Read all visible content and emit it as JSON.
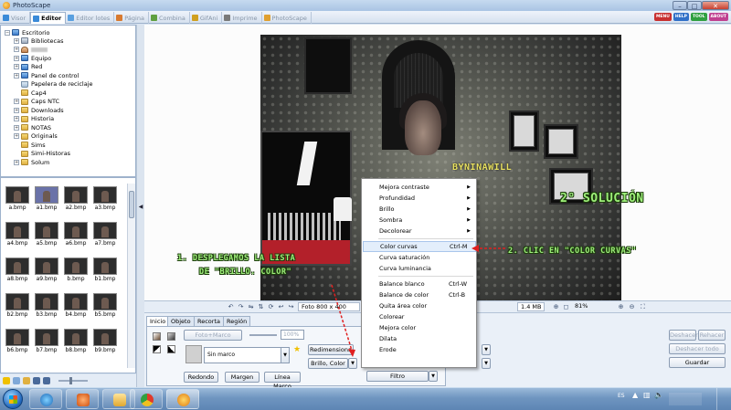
{
  "window": {
    "title": "PhotoScape",
    "min": "–",
    "max": "□",
    "close": "✕"
  },
  "tabs": [
    {
      "label": "Visor",
      "color": "#3a8ad8",
      "active": false
    },
    {
      "label": "Editor",
      "color": "#3a8ad8",
      "active": true
    },
    {
      "label": "Editor lotes",
      "color": "#5aa0e0",
      "active": false
    },
    {
      "label": "Página",
      "color": "#d87a30",
      "active": false
    },
    {
      "label": "Combina",
      "color": "#60a040",
      "active": false
    },
    {
      "label": "GifAni",
      "color": "#d0a020",
      "active": false
    },
    {
      "label": "Imprime",
      "color": "#7a7a7a",
      "active": false
    },
    {
      "label": "PhotoScape",
      "color": "#e0a030",
      "active": false
    }
  ],
  "header_buttons": [
    {
      "label": "MENU",
      "color": "#c83030"
    },
    {
      "label": "HELP",
      "color": "#3070c8"
    },
    {
      "label": "TOOL",
      "color": "#30a040"
    },
    {
      "label": "ABOUT",
      "color": "#c04090"
    }
  ],
  "tree": {
    "root": "Escritorio",
    "items": [
      {
        "label": "Bibliotecas",
        "icon": "library",
        "expander": "+"
      },
      {
        "label": "",
        "icon": "user",
        "expander": "+"
      },
      {
        "label": "Equipo",
        "icon": "computer",
        "expander": "+"
      },
      {
        "label": "Red",
        "icon": "network",
        "expander": "+"
      },
      {
        "label": "Panel de control",
        "icon": "control",
        "expander": "+"
      },
      {
        "label": "Papelera de reciclaje",
        "icon": "bin",
        "expander": ""
      },
      {
        "label": "Cap4",
        "icon": "folder",
        "expander": ""
      },
      {
        "label": "Caps NTC",
        "icon": "folder",
        "expander": "+"
      },
      {
        "label": "Downloads",
        "icon": "folder",
        "expander": "+"
      },
      {
        "label": "Historia",
        "icon": "folder",
        "expander": "+"
      },
      {
        "label": "NOTAS",
        "icon": "folder",
        "expander": "+"
      },
      {
        "label": "Originals",
        "icon": "folder",
        "expander": "+"
      },
      {
        "label": "Sims",
        "icon": "folder",
        "expander": ""
      },
      {
        "label": "Simi-Historas",
        "icon": "folder",
        "expander": ""
      },
      {
        "label": "Solum",
        "icon": "folder",
        "expander": "+"
      }
    ]
  },
  "thumbnails": [
    "a.bmp",
    "a1.bmp",
    "a2.bmp",
    "a3.bmp",
    "a4.bmp",
    "a5.bmp",
    "a6.bmp",
    "a7.bmp",
    "a8.bmp",
    "a9.bmp",
    "b.bmp",
    "b1.bmp",
    "b2.bmp",
    "b3.bmp",
    "b4.bmp",
    "b5.bmp",
    "b6.bmp",
    "b7.bmp",
    "b8.bmp",
    "b9.bmp"
  ],
  "canvas": {
    "watermark": "BYNINAWILL",
    "annotation_solution": "2° SOLUCIÓN",
    "annotation_step1_line1": "1. DESPLEGAMOS LA LISTA",
    "annotation_step1_line2": "DE \"BRILLO. COLOR\"",
    "annotation_step2": "2. CLIC EN \"COLOR CURVAS\""
  },
  "context_menu": {
    "items": [
      {
        "label": "Mejora contraste",
        "shortcut": "",
        "submenu": true
      },
      {
        "label": "Profundidad",
        "shortcut": "",
        "submenu": true
      },
      {
        "label": "Brillo",
        "shortcut": "",
        "submenu": true
      },
      {
        "label": "Sombra",
        "shortcut": "",
        "submenu": true
      },
      {
        "label": "Decolorear",
        "shortcut": "",
        "submenu": true
      },
      {
        "sep": true
      },
      {
        "label": "Color curvas",
        "shortcut": "Ctrl-M",
        "submenu": false,
        "highlight": true
      },
      {
        "label": "Curva saturación",
        "shortcut": "",
        "submenu": false
      },
      {
        "label": "Curva luminancia",
        "shortcut": "",
        "submenu": false
      },
      {
        "sep": true
      },
      {
        "label": "Balance blanco",
        "shortcut": "Ctrl-W",
        "submenu": false
      },
      {
        "label": "Balance de color",
        "shortcut": "Ctrl-B",
        "submenu": false
      },
      {
        "label": "Quita área color",
        "shortcut": "",
        "submenu": false
      },
      {
        "label": "Colorear",
        "shortcut": "",
        "submenu": false
      },
      {
        "label": "Mejora color",
        "shortcut": "",
        "submenu": false
      },
      {
        "label": "Dilata",
        "shortcut": "",
        "submenu": false
      },
      {
        "label": "Erode",
        "shortcut": "",
        "submenu": false
      }
    ]
  },
  "statusbar": {
    "photo_size": "Foto 800 x 400",
    "file_size": "1.4 MB",
    "zoom": "81%"
  },
  "bottom_panel": {
    "tabs": [
      "Inicio",
      "Objeto",
      "Recorta",
      "Región"
    ],
    "foto_marco": "Foto+Marco",
    "percent": "100%",
    "frame_select": "Sin marco",
    "redondo": "Redondo",
    "margen": "Margen",
    "linea_marco": "Línea Marco",
    "redimensiona": "Redimensiona",
    "brillo_color": "Brillo, Color",
    "filtro": "Filtro",
    "deshacer": "Deshacer",
    "rehacer": "Rehacer",
    "deshacer_todo": "Deshacer todo",
    "guardar": "Guardar"
  },
  "tray": {
    "lang": "ES"
  }
}
